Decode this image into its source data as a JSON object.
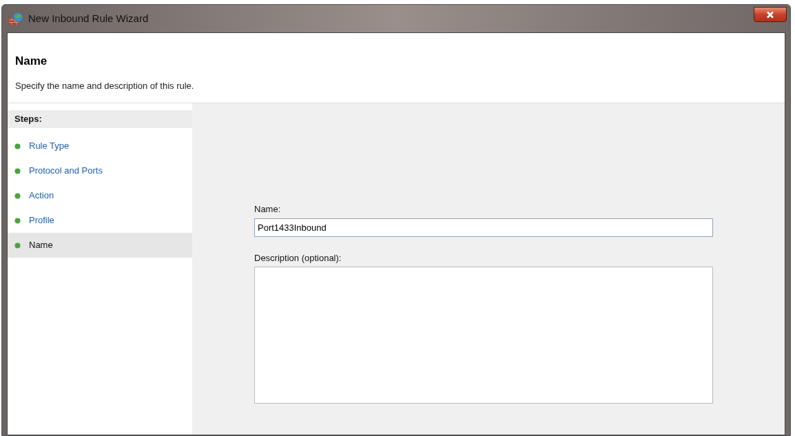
{
  "window": {
    "title": "New Inbound Rule Wizard"
  },
  "header": {
    "title": "Name",
    "subtitle": "Specify the name and description of this rule."
  },
  "steps": {
    "heading": "Steps:",
    "items": [
      {
        "label": "Rule Type",
        "selected": false
      },
      {
        "label": "Protocol and Ports",
        "selected": false
      },
      {
        "label": "Action",
        "selected": false
      },
      {
        "label": "Profile",
        "selected": false
      },
      {
        "label": "Name",
        "selected": true
      }
    ]
  },
  "form": {
    "name_label": "Name:",
    "name_value": "Port1433Inbound",
    "description_label": "Description (optional):"
  }
}
